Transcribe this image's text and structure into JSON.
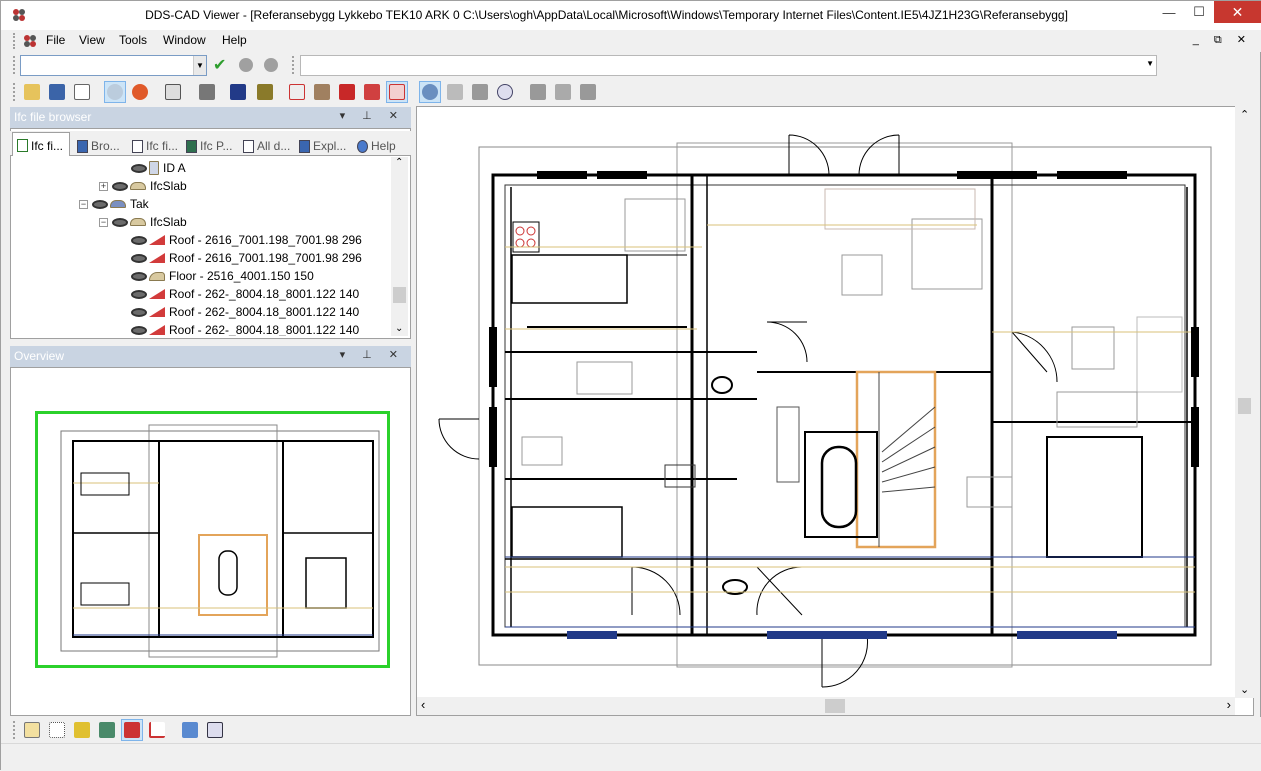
{
  "window": {
    "title": "DDS-CAD Viewer - [Referansebygg Lykkebo TEK10 ARK  0  C:\\Users\\ogh\\AppData\\Local\\Microsoft\\Windows\\Temporary Internet Files\\Content.IE5\\4JZ1H23G\\Referansebygg]",
    "min_label": "—",
    "max_label": "☐",
    "close_label": "✕",
    "mdi_controls": "_ ⧉ ✕"
  },
  "menu": {
    "items": [
      "File",
      "View",
      "Tools",
      "Window",
      "Help"
    ]
  },
  "toolbar1": {
    "combo_left_value": "",
    "combo_right_value": "",
    "dropdown_glyph": "▼",
    "ok_glyph": "✔"
  },
  "toolbar2": {
    "icons": [
      "open-folder-icon",
      "save-icon",
      "close-file-icon",
      "eye-view-icon",
      "render-icon",
      "zoom-window-icon",
      "camera-icon",
      "north-icon",
      "box-model-icon",
      "cube-red-icon",
      "cube-grey-icon",
      "cube-red2-icon",
      "cube-light-icon",
      "cube-selected-icon",
      "refresh-icon",
      "walk-icon",
      "fly-icon",
      "zoom-icon",
      "walk2-icon",
      "walk3-icon",
      "stop-icon"
    ]
  },
  "ifc_browser": {
    "title": "Ifc file browser",
    "ctrls": "▾ ⊥ ✕",
    "tabs": [
      "Ifc fi...",
      "Bro...",
      "Ifc fi...",
      "Ifc P...",
      "All d...",
      "Expl...",
      "Help"
    ],
    "tree": [
      {
        "label": "ID A",
        "kind": "id",
        "indent": 120
      },
      {
        "label": "IfcSlab",
        "kind": "slab-collapsed",
        "indent": 88
      },
      {
        "label": "Tak",
        "kind": "storey",
        "indent": 68
      },
      {
        "label": "IfcSlab",
        "kind": "slab-expanded",
        "indent": 88
      },
      {
        "label": "Roof - 2616_7001.198_7001.98 296",
        "kind": "roof",
        "indent": 120
      },
      {
        "label": "Roof - 2616_7001.198_7001.98 296",
        "kind": "roof",
        "indent": 120
      },
      {
        "label": "Floor - 2516_4001.150 150",
        "kind": "floor",
        "indent": 120
      },
      {
        "label": "Roof - 262-_8004.18_8001.122 140",
        "kind": "roof",
        "indent": 120
      },
      {
        "label": "Roof - 262-_8004.18_8001.122 140",
        "kind": "roof",
        "indent": 120
      },
      {
        "label": "Roof - 262-_8004.18_8001.122 140",
        "kind": "roof",
        "indent": 120
      }
    ]
  },
  "overview": {
    "title": "Overview",
    "ctrls": "▾ ⊥ ✕"
  },
  "scroll": {
    "up": "⌃",
    "down": "⌄",
    "left": "‹",
    "right": "›"
  },
  "bottom_toolbar": {
    "icons": [
      "layer-icon",
      "grid-icon",
      "measure-icon",
      "section-icon",
      "split-icon",
      "axis-icon",
      "image-icon",
      "close-view-icon"
    ]
  },
  "colors": {
    "accent": "#c9d4e2",
    "overview_frame": "#2bd12b",
    "close_red": "#c7372f",
    "wall": "#000000",
    "furniture": "#9a9a9a",
    "annotation_yellow": "#d8c27a",
    "stair_orange": "#e3a45a"
  }
}
